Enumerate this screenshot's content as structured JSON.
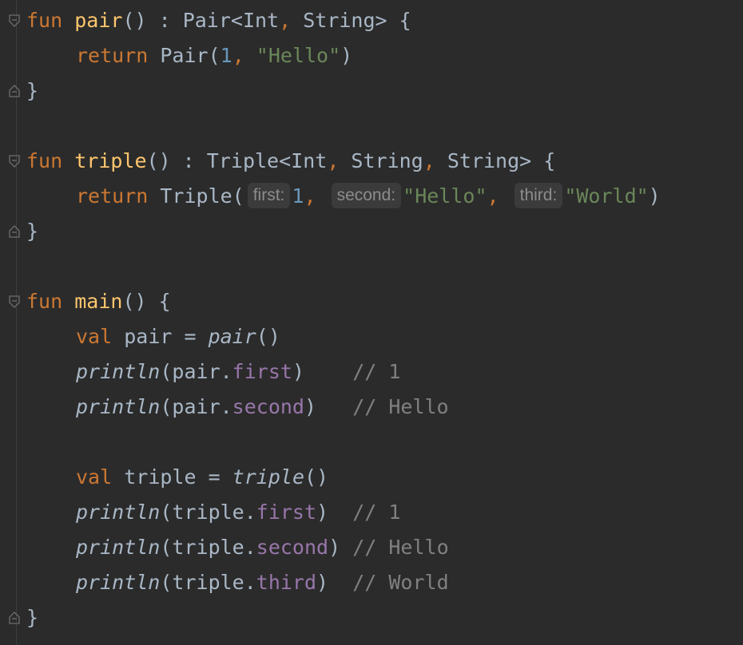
{
  "editor": {
    "lines": [
      {
        "tokens": [
          [
            "kw",
            "fun "
          ],
          [
            "fn",
            "pair"
          ],
          [
            "",
            "() : Pair<Int"
          ],
          [
            "kw",
            ", "
          ],
          [
            "",
            "String> {"
          ]
        ]
      },
      {
        "tokens": [
          [
            "kw",
            "return "
          ],
          [
            "",
            "Pair("
          ],
          [
            "num",
            "1"
          ],
          [
            "kw",
            ", "
          ],
          [
            "str",
            "\"Hello\""
          ],
          [
            "",
            ")"
          ]
        ]
      },
      {
        "tokens": [
          [
            "",
            "}"
          ]
        ]
      },
      {
        "tokens": [
          [
            "kw",
            "fun "
          ],
          [
            "fn",
            "triple"
          ],
          [
            "",
            "() : Triple<Int"
          ],
          [
            "kw",
            ", "
          ],
          [
            "",
            "String"
          ],
          [
            "kw",
            ", "
          ],
          [
            "",
            "String> {"
          ]
        ]
      },
      {
        "tokens": [
          [
            "kw",
            "return "
          ],
          [
            "",
            "Triple("
          ]
        ]
      },
      {
        "tokens": [
          [
            "",
            "}"
          ]
        ]
      },
      {
        "tokens": [
          [
            "kw",
            "fun "
          ],
          [
            "fn",
            "main"
          ],
          [
            "",
            "() {"
          ]
        ]
      },
      {
        "tokens": [
          [
            "kw",
            "val "
          ],
          [
            "",
            "pair = "
          ],
          [
            "it",
            "pair"
          ],
          [
            "",
            "()"
          ]
        ]
      },
      {
        "tokens": [
          [
            "it",
            "println"
          ],
          [
            "",
            "(pair."
          ],
          [
            "prop",
            "first"
          ],
          [
            "",
            ")"
          ],
          [
            "cmt",
            "    // 1"
          ]
        ]
      },
      {
        "tokens": [
          [
            "it",
            "println"
          ],
          [
            "",
            "(pair."
          ],
          [
            "prop",
            "second"
          ],
          [
            "",
            ")"
          ],
          [
            "cmt",
            "   // Hello"
          ]
        ]
      },
      {
        "tokens": [
          [
            "kw",
            "val "
          ],
          [
            "",
            "triple = "
          ],
          [
            "it",
            "triple"
          ],
          [
            "",
            "()"
          ]
        ]
      },
      {
        "tokens": [
          [
            "it",
            "println"
          ],
          [
            "",
            "(triple."
          ],
          [
            "prop",
            "first"
          ],
          [
            "",
            ")"
          ],
          [
            "cmt",
            "  // 1"
          ]
        ]
      },
      {
        "tokens": [
          [
            "it",
            "println"
          ],
          [
            "",
            "(triple."
          ],
          [
            "prop",
            "second"
          ],
          [
            "",
            ")"
          ],
          [
            "cmt",
            " // Hello"
          ]
        ]
      },
      {
        "tokens": [
          [
            "it",
            "println"
          ],
          [
            "",
            "(triple."
          ],
          [
            "prop",
            "third"
          ],
          [
            "",
            ")"
          ],
          [
            "cmt",
            "  // World"
          ]
        ]
      },
      {
        "tokens": [
          [
            "",
            "}"
          ]
        ]
      }
    ],
    "triple_call": {
      "hint_first": "first:",
      "arg_first": "1",
      "sep1": ",",
      "hint_second": "second:",
      "arg_second": "\"Hello\"",
      "sep2": ",",
      "hint_third": "third:",
      "arg_third": "\"World\"",
      "close": ")"
    }
  },
  "colors": {
    "background": "#2b2b2b",
    "keyword": "#cc7832",
    "function": "#ffc66d",
    "number": "#6897bb",
    "string": "#6a8759",
    "property": "#9876aa",
    "comment": "#808080",
    "text": "#a9b7c6"
  }
}
